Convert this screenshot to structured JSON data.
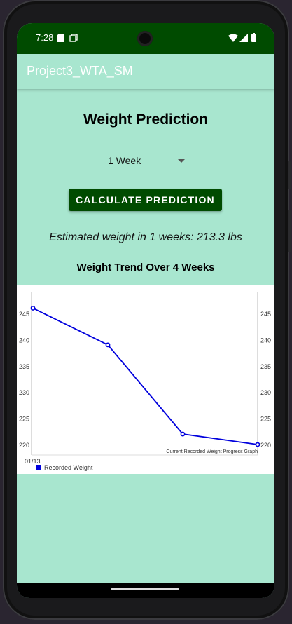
{
  "status_bar": {
    "time": "7:28",
    "icons": [
      "sim-card-icon",
      "screenshot-icon",
      "wifi-icon",
      "signal-icon",
      "battery-icon"
    ]
  },
  "app_bar": {
    "title": "Project3_WTA_SM"
  },
  "main": {
    "heading": "Weight Prediction",
    "period_select": {
      "selected": "1 Week"
    },
    "calculate_button": "CALCULATE PREDICTION",
    "estimate_text": "Estimated weight in 1 weeks: 213.3 lbs",
    "chart_title": "Weight Trend Over 4 Weeks"
  },
  "colors": {
    "background": "#a8e6cf",
    "status_bar": "#004b00",
    "button": "#004b00",
    "series_line": "#0000dd"
  },
  "chart_data": {
    "type": "line",
    "x": [
      "01/13",
      "",
      "",
      ""
    ],
    "series": [
      {
        "name": "Recorded Weight",
        "values": [
          246,
          239,
          222,
          220
        ]
      }
    ],
    "y_ticks": [
      220,
      225,
      230,
      235,
      240,
      245
    ],
    "ylim": [
      218,
      249
    ],
    "description": "Current Recorded Weight Progress Graph",
    "legend_placement": "bottom-left",
    "grid": false
  }
}
